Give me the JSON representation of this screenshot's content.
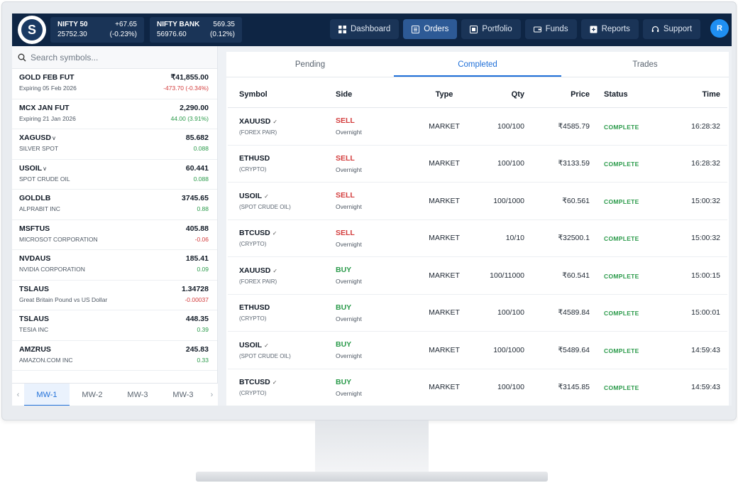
{
  "tickers": [
    {
      "name": "NIFTY 50",
      "change": "+67.65",
      "price": "25752.30",
      "pct": "(-0.23%)"
    },
    {
      "name": "NIFTY BANK",
      "change": "569.35",
      "price": "56976.60",
      "pct": "(0.12%)"
    }
  ],
  "nav": [
    {
      "label": "Dashboard",
      "icon": "grid-icon",
      "active": false
    },
    {
      "label": "Orders",
      "icon": "list-icon",
      "active": true
    },
    {
      "label": "Portfolio",
      "icon": "portfolio-icon",
      "active": false
    },
    {
      "label": "Funds",
      "icon": "wallet-icon",
      "active": false
    },
    {
      "label": "Reports",
      "icon": "report-icon",
      "active": false
    },
    {
      "label": "Support",
      "icon": "headset-icon",
      "active": false
    }
  ],
  "avatar": "R",
  "search": {
    "placeholder": "Search symbols..."
  },
  "watchlist": [
    {
      "symbol": "GOLD FEB FUT",
      "sub": "Expiring 05 Feb 2026",
      "price": "₹41,855.00",
      "change": "-473.70 (-0.34%)",
      "dir": "down"
    },
    {
      "symbol": "MCX JAN FUT",
      "sub": "Expiring 21 Jan 2026",
      "price": "2,290.00",
      "change": "44.00 (3.91%)",
      "dir": "up"
    },
    {
      "symbol": "XAGUSD",
      "chev": true,
      "sub": "SILVER SPOT",
      "price": "85.682",
      "change": "0.088",
      "dir": "up"
    },
    {
      "symbol": "USOIL",
      "chev": true,
      "sub": "SPOT CRUDE OIL",
      "price": "60.441",
      "change": "0.088",
      "dir": "up"
    },
    {
      "symbol": "GOLDLB",
      "sub": "ALPRABIT INC",
      "price": "3745.65",
      "change": "0.88",
      "dir": "up"
    },
    {
      "symbol": "MSFTUS",
      "sub": "MICROSOT CORPORATION",
      "price": "405.88",
      "change": "-0.06",
      "dir": "down"
    },
    {
      "symbol": "NVDAUS",
      "sub": "NVIDIA CORPORATION",
      "price": "185.41",
      "change": "0.09",
      "dir": "up"
    },
    {
      "symbol": "TSLAUS",
      "sub": "Great Britain Pound vs US Dollar",
      "price": "1.34728",
      "change": "-0.00037",
      "dir": "down"
    },
    {
      "symbol": "TSLAUS",
      "sub": "TESIA INC",
      "price": "448.35",
      "change": "0.39",
      "dir": "up"
    },
    {
      "symbol": "AMZRUS",
      "sub": "AMAZON.COM INC",
      "price": "245.83",
      "change": "0.33",
      "dir": "up"
    }
  ],
  "mw_tabs": [
    "MW-1",
    "MW-2",
    "MW-3",
    "MW-3"
  ],
  "tabs": [
    "Pending",
    "Completed",
    "Trades"
  ],
  "columns": [
    "Symbol",
    "Side",
    "Type",
    "Qty",
    "Price",
    "Status",
    "Time"
  ],
  "orders": [
    {
      "symbol": "XAUUSD",
      "chev": "✓",
      "sub": "(FOREX PAIR)",
      "side": "SELL",
      "product": "Overnight",
      "type": "MARKET",
      "qty": "100/100",
      "price": "₹4585.79",
      "status": "COMPLETE",
      "time": "16:28:32"
    },
    {
      "symbol": "ETHUSD",
      "chev": "",
      "sub": "(CRYPTO)",
      "side": "SELL",
      "product": "Overnight",
      "type": "MARKET",
      "qty": "100/100",
      "price": "₹3133.59",
      "status": "COMPLETE",
      "time": "16:28:32"
    },
    {
      "symbol": "USOIL",
      "chev": "✓",
      "sub": "(SPOT CRUDE OIL)",
      "side": "SELL",
      "product": "Overnight",
      "type": "MARKET",
      "qty": "100/1000",
      "price": "₹60.561",
      "status": "COMPLETE",
      "time": "15:00:32"
    },
    {
      "symbol": "BTCUSD",
      "chev": "✓",
      "sub": "(CRYPTO)",
      "side": "SELL",
      "product": "Overnight",
      "type": "MARKET",
      "qty": "10/10",
      "price": "₹32500.1",
      "status": "COMPLETE",
      "time": "15:00:32"
    },
    {
      "symbol": "XAUUSD",
      "chev": "✓",
      "sub": "(FOREX PAIR)",
      "side": "BUY",
      "product": "Overnight",
      "type": "MARKET",
      "qty": "100/11000",
      "price": "₹60.541",
      "status": "COMPLETE",
      "time": "15:00:15"
    },
    {
      "symbol": "ETHUSD",
      "chev": "",
      "sub": "(CRYPTO)",
      "side": "BUY",
      "product": "Overnight",
      "type": "MARKET",
      "qty": "100/100",
      "price": "₹4589.84",
      "status": "COMPLETE",
      "time": "15:00:01"
    },
    {
      "symbol": "USOIL",
      "chev": "✓",
      "sub": "(SPOT CRUDE OIL)",
      "side": "BUY",
      "product": "Overnight",
      "type": "MARKET",
      "qty": "100/1000",
      "price": "₹5489.64",
      "status": "COMPLETE",
      "time": "14:59:43"
    },
    {
      "symbol": "BTCUSD",
      "chev": "✓",
      "sub": "(CRYPTO)",
      "side": "BUY",
      "product": "Overnight",
      "type": "MARKET",
      "qty": "100/100",
      "price": "₹3145.85",
      "status": "COMPLETE",
      "time": "14:59:43"
    }
  ],
  "colors": {
    "sell": "#d33c3c",
    "buy": "#2a9a4a",
    "accent": "#1f6fd8",
    "topbar": "#0e2544"
  }
}
